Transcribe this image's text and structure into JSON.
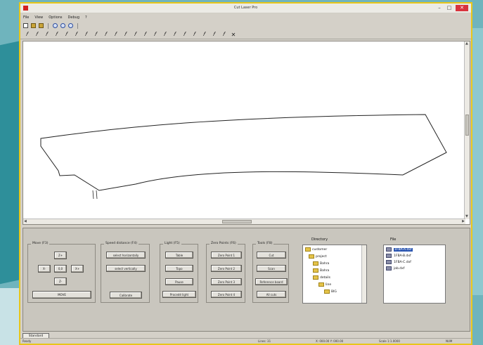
{
  "window": {
    "title": "Cut Laser Pro"
  },
  "menu": [
    "File",
    "View",
    "Options",
    "Debug",
    "?"
  ],
  "toolbar_icons": [
    "new-doc",
    "open-folder",
    "save",
    "zoom-in",
    "zoom-out",
    "zoom-fit"
  ],
  "tool_glyphs": [
    "𝑓",
    "𝑓",
    "𝑓",
    "𝑓",
    "𝑓",
    "𝑓",
    "𝑓",
    "𝑓",
    "𝑓",
    "𝑓",
    "𝑓",
    "𝑓",
    "𝑓",
    "𝑓",
    "𝑓",
    "𝑓",
    "𝑓",
    "𝑓",
    "𝑓",
    "𝑓",
    "𝑓",
    "✕"
  ],
  "panel": {
    "move": {
      "label": "Move  (F3)",
      "buttons": [
        "Z+",
        "X-",
        "0,0",
        "X+",
        "Z-",
        "Y-"
      ],
      "action": "MOVE"
    },
    "scan": {
      "label": "Speed distance  (F4)",
      "buttons": [
        "select horizontally",
        "select vertically",
        "Calibrate"
      ]
    },
    "light": {
      "label": "Light  (F5)",
      "buttons": [
        "Table",
        "Topo",
        "Pause",
        "Procedé light"
      ]
    },
    "points": {
      "label": "Zero Points  (F6)",
      "buttons": [
        "Zero Point 1",
        "Zero Point 2",
        "Zero Point 3",
        "Zero Point 4"
      ]
    },
    "tools": {
      "label": "Tools  (F8)",
      "buttons": [
        "Cut",
        "Scan",
        "Reference board",
        "All cuts"
      ]
    },
    "directory": {
      "label": "Directory",
      "tree": [
        "customer",
        "project",
        "Bahra",
        "Bahra",
        "details",
        "line",
        "BIG"
      ]
    },
    "files": {
      "label": "File",
      "items": [
        "1FBA-A.dxf",
        "1FBA-B.dxf",
        "1FBA-C.dxf",
        "job.dxf"
      ],
      "selected": 0
    }
  },
  "tab": "Standard",
  "status": {
    "left": "Ready",
    "c1": "Lines: 31",
    "c2": "X: 000.00 Y: 000.00",
    "c3": "Scale 1:1.0000",
    "c4": "NUM"
  },
  "colors": {
    "accent_border": "#e8c61a",
    "selection": "#2a55b0"
  }
}
